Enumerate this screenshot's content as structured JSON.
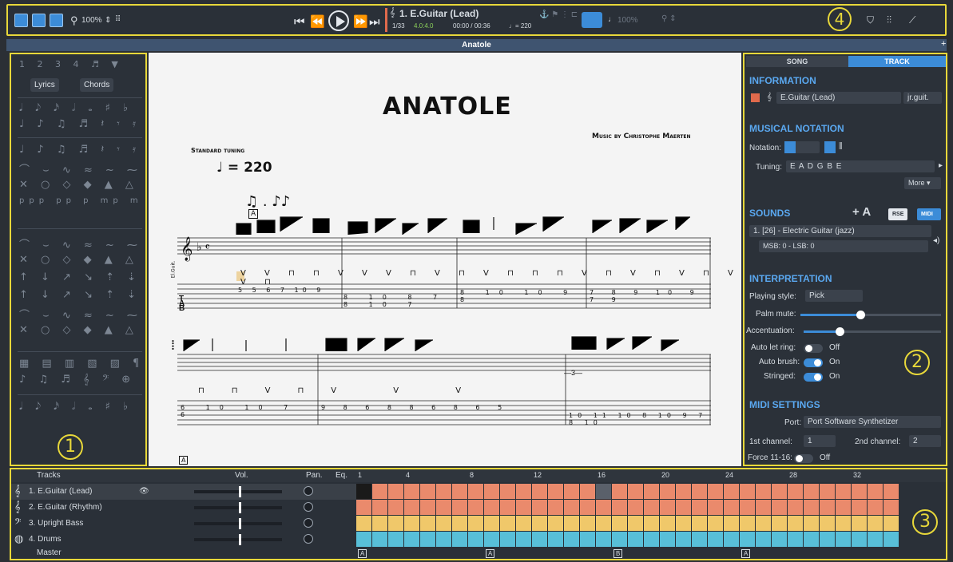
{
  "toolbar": {
    "zoom": "100%",
    "track_title": "1. E.Guitar (Lead)",
    "bar_pos": "1/33",
    "time_sig": "4.0:4.0",
    "time": "00:00 / 00:36",
    "tempo": "♩= 220",
    "speed": "100%",
    "circle": "4"
  },
  "window": {
    "title": "Anatole"
  },
  "left": {
    "lyrics": "Lyrics",
    "chords": "Chords",
    "circle": "1",
    "rows": [
      "1 2 3 4 ♬ ▼",
      "𝅘𝅥 𝅘𝅥𝅮 𝅘𝅥𝅯 𝅗𝅥 𝅝 ♯ ♭",
      "♩ ♪ ♫ ♬ 𝄽 𝄾 𝄿",
      "ppp pp p mp mf f ff",
      "⌒ ⌣ ∿ ≈ ~ ⁓",
      "✕ ○ ◇ ◆ ▲ △ ▽",
      "↑ ↓ ↗ ↘ ⇡ ⇣ ⇢",
      "♪ ♫ ♬ 𝄞 𝄢 ⊕",
      "▦ ▤ ▥ ▧ ▨ ¶"
    ]
  },
  "score": {
    "title": "ANATOLE",
    "composer": "Music by Christophe Maerten",
    "tuning_label": "Standard tuning",
    "tempo": "♩ = 220",
    "track_name": "El.Guit.",
    "marker": "A",
    "tab1": [
      "5",
      "5",
      "6",
      "7",
      "10",
      "9",
      "7",
      "6",
      "9",
      "8",
      "10",
      "8",
      "7",
      "8",
      "10",
      "7",
      "8",
      "10",
      "9",
      "8",
      "10",
      "9",
      "8",
      "7",
      "8",
      "9",
      "10",
      "9",
      "7",
      "8",
      "9"
    ],
    "tab2": [
      "6",
      "10",
      "10",
      "7",
      "6",
      "9",
      "8",
      "6",
      "8",
      "8",
      "6",
      "8",
      "6",
      "5",
      "10",
      "11",
      "10",
      "8",
      "10",
      "9",
      "7",
      "8",
      "10"
    ]
  },
  "right": {
    "tab_song": "SONG",
    "tab_track": "TRACK",
    "info": "INFORMATION",
    "track_name": "E.Guitar (Lead)",
    "short_name": "jr.guit.",
    "notation": "MUSICAL NOTATION",
    "notation_label": "Notation:",
    "tuning_label": "Tuning:",
    "tuning": "E A D G B E",
    "more": "More ▾",
    "sounds": "SOUNDS",
    "rse": "RSE",
    "midi": "MIDI",
    "sound": "1. [26] - Electric Guitar (jazz)",
    "msb": "MSB: 0 - LSB: 0",
    "interp": "INTERPRETATION",
    "playing_style_label": "Playing style:",
    "playing_style": "Pick",
    "palm_label": "Palm mute:",
    "accent_label": "Accentuation:",
    "autolet_label": "Auto let ring:",
    "off": "Off",
    "on": "On",
    "autobrush_label": "Auto brush:",
    "stringed_label": "Stringed:",
    "midi_settings": "MIDI SETTINGS",
    "port_label": "Port:",
    "port": "Port Software Synthetizer",
    "ch1_label": "1st channel:",
    "ch1": "1",
    "ch2_label": "2nd channel:",
    "ch2": "2",
    "force_label": "Force 11-16:",
    "circle": "2"
  },
  "tracks": {
    "header": "Tracks",
    "vol": "Vol.",
    "pan": "Pan.",
    "eq": "Eq.",
    "master": "Master",
    "circle": "3",
    "rows": [
      {
        "name": "1. E.Guitar (Lead)",
        "color": "#ea8a6c"
      },
      {
        "name": "2. E.Guitar (Rhythm)",
        "color": "#ea8a6c"
      },
      {
        "name": "3. Upright Bass",
        "color": "#f0c86a"
      },
      {
        "name": "4. Drums",
        "color": "#58bfd8"
      }
    ],
    "bars": [
      "1",
      "4",
      "8",
      "12",
      "16",
      "20",
      "24",
      "28",
      "32"
    ],
    "markers": [
      "A",
      "A",
      "B",
      "A"
    ]
  }
}
